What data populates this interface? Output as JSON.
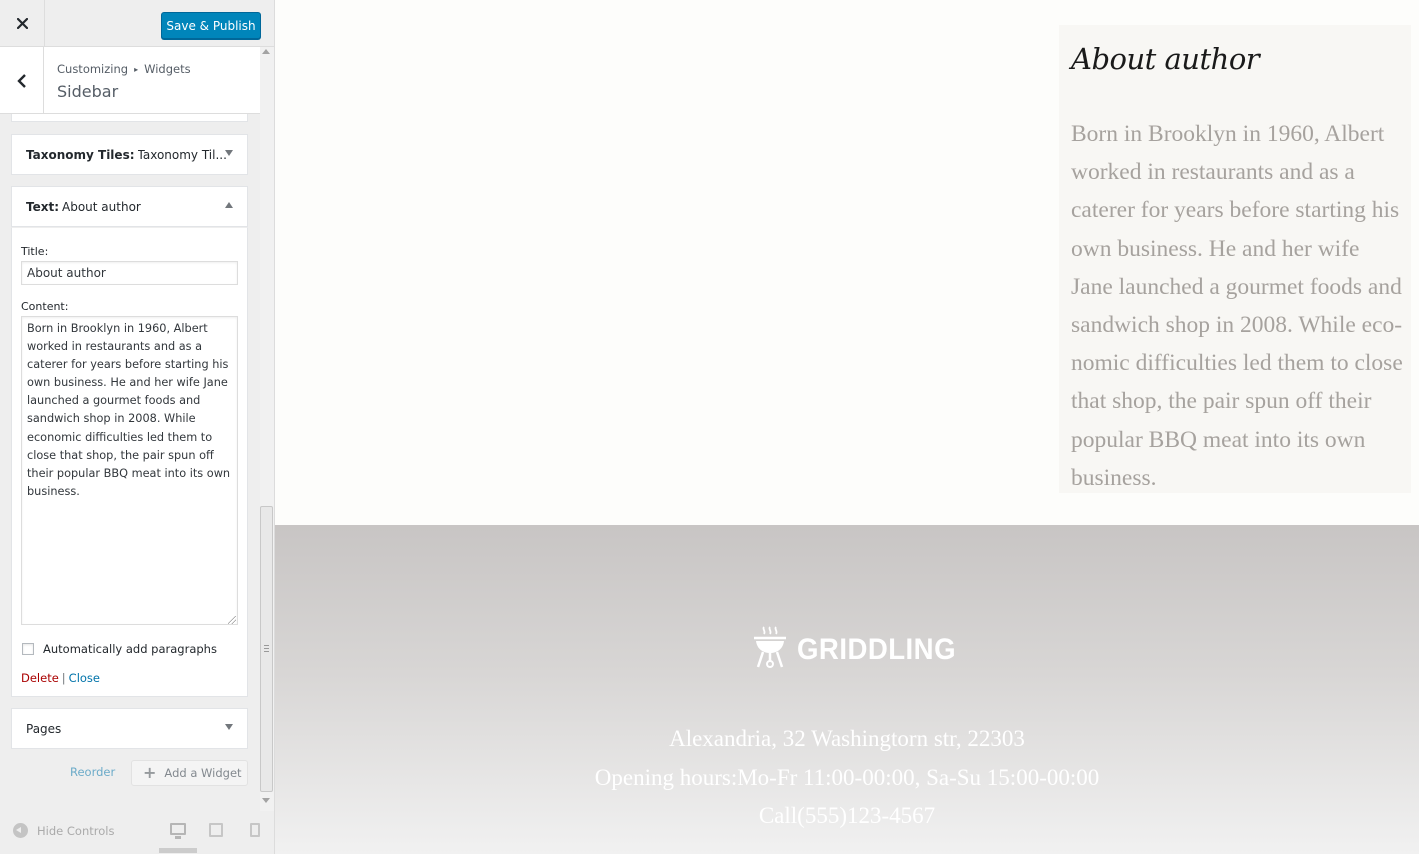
{
  "topbar": {
    "close_icon": "close-x-icon",
    "save_label": "Save & Publish"
  },
  "section": {
    "back_icon": "chevron-left-icon",
    "breadcrumb_root": "Customizing",
    "breadcrumb_sep": "▸",
    "breadcrumb_current": "Widgets",
    "title": "Sidebar"
  },
  "widgets": {
    "taxonomy": {
      "type": "Taxonomy Tiles:",
      "title": "Taxonomy Til..."
    },
    "text": {
      "type": "Text:",
      "title": "About author",
      "title_label": "Title:",
      "title_value": "About author",
      "content_label": "Content:",
      "content_value": "Born in Brooklyn in 1960, Albert worked in restaurants and as a caterer for years before starting his own business. He and her wife Jane launched a gourmet foods and sandwich shop in 2008. While economic difficulties led them to close that shop, the pair spun off their popular BBQ meat into its own business.",
      "auto_paragraphs_label": "Automatically add paragraphs",
      "auto_paragraphs_checked": false,
      "delete_label": "Delete",
      "separator": "|",
      "close_label": "Close"
    },
    "pages": {
      "title": "Pages"
    }
  },
  "sidebar_actions": {
    "reorder_label": "Reorder",
    "add_widget_label": "Add a Widget"
  },
  "footer_controls": {
    "hide_controls_label": "Hide Controls",
    "devices": [
      "desktop",
      "tablet",
      "mobile"
    ],
    "active_device": "desktop"
  },
  "preview": {
    "widget_title": "About author",
    "widget_text": "Born in Brooklyn in 1960, Albert worked in restaurants and as a caterer for years before starting his own business. He and her wife Jane launched a gourmet foods and sandwich shop in 2008. While eco-nomic difficulties led them to close that shop, the pair spun off their popular BBQ meat into its own business.",
    "footer": {
      "logo_text": "GRIDDLING",
      "logo_icon": "grill-icon",
      "address": "Alexandria, 32 Washingtorn str, 22303",
      "hours": "Opening hours:Mo-Fr 11:00-00:00, Sa-Su 15:00-00:00",
      "phone": "Call(555)123-4567"
    }
  },
  "colors": {
    "primary_button": "#0085ba",
    "delete_link": "#aa0000",
    "link": "#0073aa",
    "preview_text": "#a6a29e"
  }
}
